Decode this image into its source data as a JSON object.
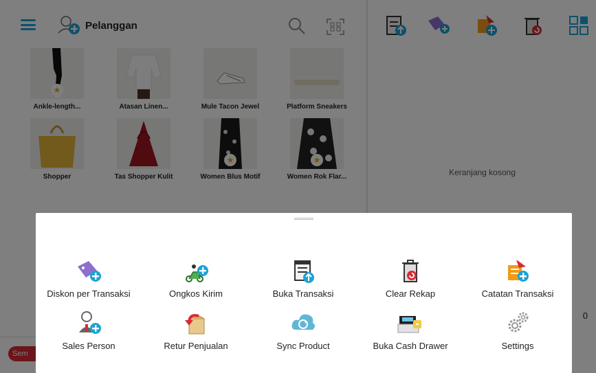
{
  "topbar": {
    "customer_label": "Pelanggan"
  },
  "products": [
    {
      "name": "Ankle-length...",
      "favorite": true
    },
    {
      "name": "Atasan Linen...",
      "favorite": false
    },
    {
      "name": "Mule Tacon Jewel",
      "favorite": false
    },
    {
      "name": "Platform Sneakers",
      "favorite": false
    },
    {
      "name": "Shopper",
      "favorite": false
    },
    {
      "name": "Tas Shopper Kulit",
      "favorite": false
    },
    {
      "name": "Women Blus Motif",
      "favorite": true
    },
    {
      "name": "Women Rok Flar...",
      "favorite": true
    }
  ],
  "cart": {
    "empty_text": "Keranjang kosong",
    "total_value": "0",
    "badge_label": "Sem"
  },
  "sheet": {
    "actions": [
      {
        "label": "Diskon per Transaksi",
        "icon": "discount-tag-icon"
      },
      {
        "label": "Ongkos Kirim",
        "icon": "delivery-scooter-icon"
      },
      {
        "label": "Buka Transaksi",
        "icon": "open-transaction-icon"
      },
      {
        "label": "Clear Rekap",
        "icon": "clear-trash-icon"
      },
      {
        "label": "Catatan Transaksi",
        "icon": "transaction-note-icon"
      },
      {
        "label": "Sales Person",
        "icon": "sales-person-icon"
      },
      {
        "label": "Retur Penjualan",
        "icon": "sales-return-icon"
      },
      {
        "label": "Sync Product",
        "icon": "cloud-sync-icon"
      },
      {
        "label": "Buka Cash Drawer",
        "icon": "cash-drawer-icon"
      },
      {
        "label": "Settings",
        "icon": "gear-icon"
      }
    ]
  },
  "colors": {
    "accent": "#1aa3d6",
    "brand_purple": "#8e6ecf",
    "danger": "#d82b35",
    "orange": "#f29a17"
  }
}
